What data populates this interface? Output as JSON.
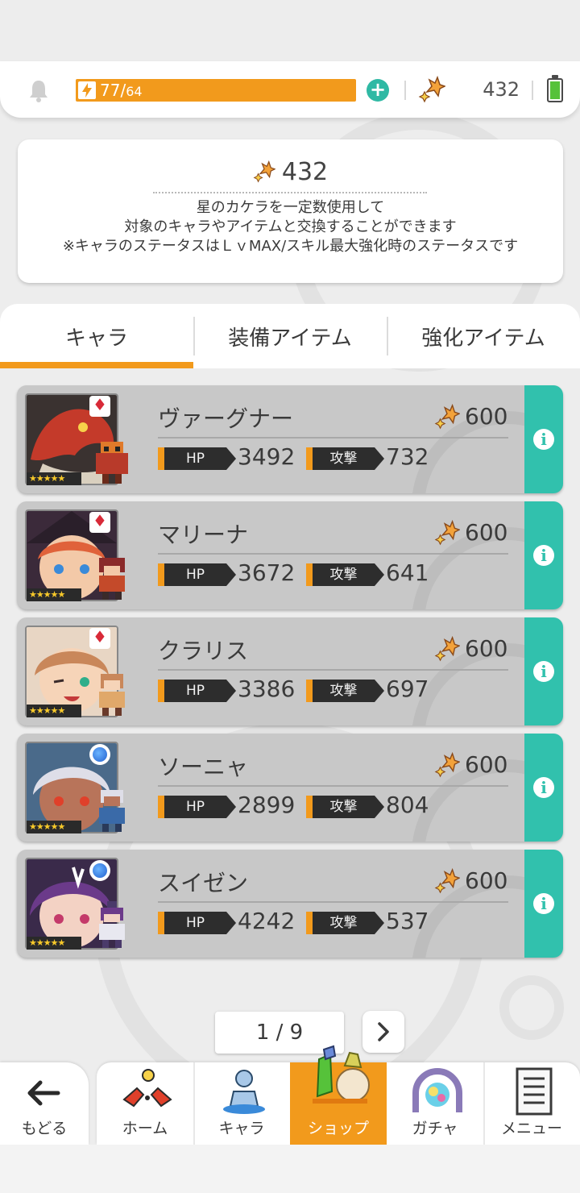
{
  "status": {
    "stamina_current": "77",
    "stamina_separator": "/",
    "stamina_max": "64",
    "star_fragments": "432"
  },
  "info": {
    "count": "432",
    "lines": [
      "星のカケラを一定数使用して",
      "対象のキャラやアイテムと交換することができます",
      "※キャラのステータスはＬｖMAX/スキル最大強化時のステータスです"
    ]
  },
  "tabs": [
    {
      "label": "キャラ",
      "active": true
    },
    {
      "label": "装備アイテム",
      "active": false
    },
    {
      "label": "強化アイテム",
      "active": false
    }
  ],
  "stat_labels": {
    "hp": "HP",
    "atk": "攻撃"
  },
  "characters": [
    {
      "name": "ヴァーグナー",
      "cost": "600",
      "hp": "3492",
      "atk": "732",
      "element": "fire",
      "rarity": "★★★★★",
      "art_color": "#c43a2a"
    },
    {
      "name": "マリーナ",
      "cost": "600",
      "hp": "3672",
      "atk": "641",
      "element": "fire",
      "rarity": "★★★★★",
      "art_color": "#e0623a"
    },
    {
      "name": "クラリス",
      "cost": "600",
      "hp": "3386",
      "atk": "697",
      "element": "fire",
      "rarity": "★★★★★",
      "art_color": "#c9875a"
    },
    {
      "name": "ソーニャ",
      "cost": "600",
      "hp": "2899",
      "atk": "804",
      "element": "water",
      "rarity": "★★★★★",
      "art_color": "#b8b8c6"
    },
    {
      "name": "スイゼン",
      "cost": "600",
      "hp": "4242",
      "atk": "537",
      "element": "water",
      "rarity": "★★★★★",
      "art_color": "#6b3a8a"
    }
  ],
  "pagination": {
    "text": "1 / 9"
  },
  "nav": {
    "back": "もどる",
    "items": [
      {
        "label": "ホーム",
        "icon": "home-icon"
      },
      {
        "label": "キャラ",
        "icon": "character-icon"
      },
      {
        "label": "ショップ",
        "icon": "shop-icon",
        "active": true
      },
      {
        "label": "ガチャ",
        "icon": "gacha-icon"
      },
      {
        "label": "メニュー",
        "icon": "menu-icon"
      }
    ]
  },
  "colors": {
    "accent": "#f29a1c",
    "teal": "#31c1ad"
  }
}
